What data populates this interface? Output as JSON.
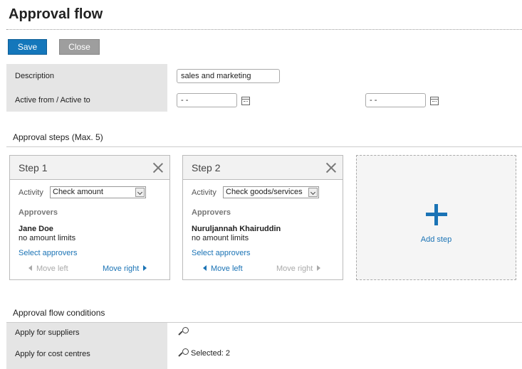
{
  "page": {
    "title": "Approval flow"
  },
  "toolbar": {
    "save_label": "Save",
    "close_label": "Close"
  },
  "form": {
    "description_label": "Description",
    "description_value": "sales and marketing",
    "active_label": "Active from / Active to",
    "active_from_value": "- -",
    "active_to_value": "- -"
  },
  "steps_section": {
    "title": "Approval steps (Max. 5)",
    "activity_label": "Activity",
    "approvers_label": "Approvers",
    "select_approvers_label": "Select approvers",
    "move_left_label": "Move left",
    "move_right_label": "Move right",
    "add_step_label": "Add step",
    "steps": [
      {
        "title": "Step 1",
        "activity": "Check amount",
        "approver_name": "Jane Doe",
        "approver_limit": "no amount limits"
      },
      {
        "title": "Step 2",
        "activity": "Check goods/services",
        "approver_name": "Nuruljannah Khairuddin",
        "approver_limit": "no amount limits"
      }
    ]
  },
  "conditions": {
    "title": "Approval flow conditions",
    "suppliers_label": "Apply for suppliers",
    "cost_centres_label": "Apply for cost centres",
    "cost_centres_selected": "Selected: 2"
  },
  "icons": {
    "calendar": "calendar-icon",
    "close": "close-icon",
    "plus": "plus-icon",
    "search": "search-icon",
    "arrow_left": "triangle-left-icon",
    "arrow_right": "triangle-right-icon"
  },
  "colors": {
    "accent": "#1477bb",
    "link": "#1a73b5",
    "label_bg": "#e5e5e5",
    "disabled": "#aaaaaa"
  }
}
